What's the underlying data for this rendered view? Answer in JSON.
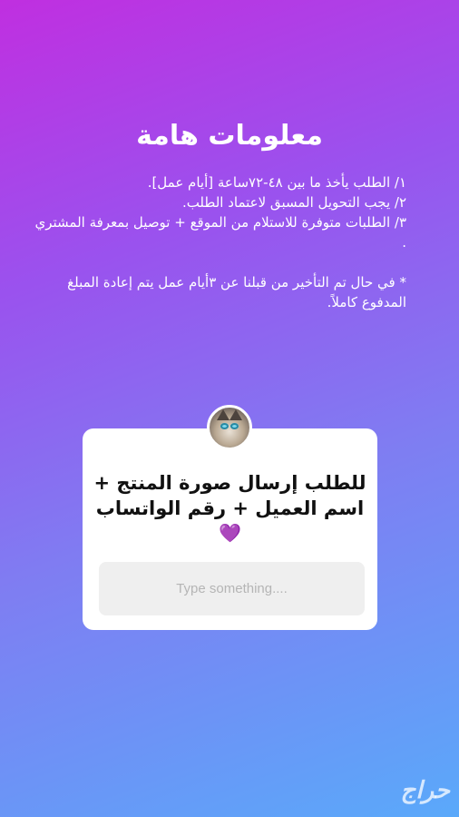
{
  "story": {
    "title": "معلومات هامة",
    "lines": [
      "١/ الطلب يأخذ ما بين ٤٨-٧٢ساعة [أيام عمل].",
      "٢/ يجب التحويل المسبق لاعتماد الطلب.",
      "٣/ الطلبات متوفرة للاستلام من الموقع + توصيل بمعرفة المشتري .",
      "* في حال تم التأخير من قبلنا عن ٣أيام عمل يتم إعادة المبلغ المدفوع كاملاً."
    ]
  },
  "question_sticker": {
    "avatar_icon": "cat-avatar",
    "question": "للطلب إرسال صورة المنتج + اسم العميل + رقم الواتساب",
    "heart": "💜",
    "answer_placeholder": "Type something...."
  },
  "watermark": "حراج",
  "colors": {
    "gradient_top": "#c02fe0",
    "gradient_bottom": "#5aa9fa",
    "heart": "#9b30d8"
  }
}
